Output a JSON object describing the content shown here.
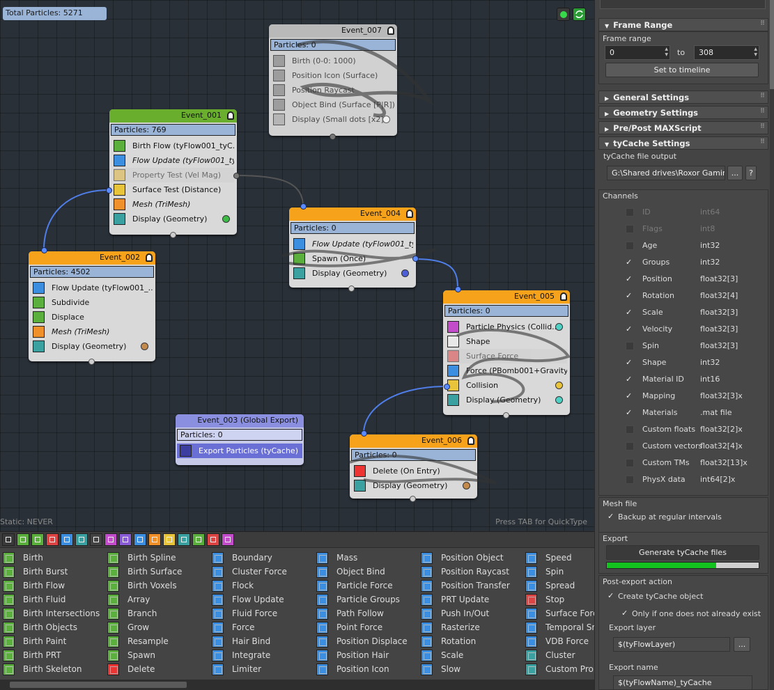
{
  "canvas": {
    "total_particles": "Total Particles: 5271",
    "static_label": "Static: NEVER",
    "tab_hint": "Press TAB for QuickType"
  },
  "colors": {
    "event_green": "#6aae2d",
    "event_orange": "#f7a21b",
    "event_purple": "#8a8fe0",
    "event_grey": "#b9b9b9",
    "particles_bar": "#9ab4d8",
    "wire_blue": "#4f7ee8",
    "wire_grey": "#555555",
    "progress_green": "#13c21f"
  },
  "events": {
    "e007": {
      "title": "Event_007",
      "count": "Particles: 0",
      "ops": [
        "Birth (0-0: 1000)",
        "Position Icon (Surface)",
        "Position Raycast",
        "Object Bind (Surface [P|R])",
        "Display (Small dots [x2])"
      ]
    },
    "e001": {
      "title": "Event_001",
      "count": "Particles: 769",
      "ops": [
        "Birth Flow (tyFlow001_tyC...",
        "Flow Update (tyFlow001_ty...",
        "Property Test (Vel Mag)",
        "Surface Test (Distance)",
        "Mesh (TriMesh)",
        "Display (Geometry)"
      ]
    },
    "e004": {
      "title": "Event_004",
      "count": "Particles: 0",
      "ops": [
        "Flow Update (tyFlow001_ty...",
        "Spawn (Once)",
        "Display (Geometry)"
      ]
    },
    "e002": {
      "title": "Event_002",
      "count": "Particles: 4502",
      "ops": [
        "Flow Update (tyFlow001_...",
        "Subdivide",
        "Displace",
        "Mesh (TriMesh)",
        "Display (Geometry)"
      ]
    },
    "e005": {
      "title": "Event_005",
      "count": "Particles: 0",
      "ops": [
        "Particle Physics (Collid...",
        "Shape",
        "Surface Force",
        "Force (PBomb001+Gravity)",
        "Collision",
        "Display (Geometry)"
      ]
    },
    "e003": {
      "title": "Event_003 (Global Export)",
      "count": "Particles: 0",
      "ops": [
        "Export Particles (tyCache)"
      ]
    },
    "e006": {
      "title": "Event_006",
      "count": "Particles: 0",
      "ops": [
        "Delete (On Entry)",
        "Display (Geometry)"
      ]
    }
  },
  "depot": {
    "columns": [
      [
        "Birth",
        "Birth Burst",
        "Birth Flow",
        "Birth Fluid",
        "Birth Intersections",
        "Birth Objects",
        "Birth Paint",
        "Birth PRT",
        "Birth Skeleton"
      ],
      [
        "Birth Spline",
        "Birth Surface",
        "Birth Voxels",
        "Array",
        "Branch",
        "Grow",
        "Resample",
        "Spawn",
        "Delete"
      ],
      [
        "Boundary",
        "Cluster Force",
        "Flock",
        "Flow Update",
        "Fluid Force",
        "Force",
        "Hair Bind",
        "Integrate",
        "Limiter"
      ],
      [
        "Mass",
        "Object Bind",
        "Particle Force",
        "Particle Groups",
        "Path Follow",
        "Point Force",
        "Position Displace",
        "Position Hair",
        "Position Icon"
      ],
      [
        "Position Object",
        "Position Raycast",
        "Position Transfer",
        "PRT Update",
        "Push In/Out",
        "Rasterize",
        "Rotation",
        "Scale",
        "Slow"
      ],
      [
        "Speed",
        "Spin",
        "Spread",
        "Stop",
        "Surface Force",
        "Temporal Sm",
        "VDB Force",
        "Cluster",
        "Custom Prop"
      ]
    ]
  },
  "panel": {
    "frame_range": {
      "header": "Frame Range",
      "label": "Frame range",
      "from": "0",
      "to_label": "to",
      "to": "308",
      "set_button": "Set to timeline"
    },
    "rollouts": {
      "general": "General Settings",
      "geometry": "Geometry Settings",
      "prepost": "Pre/Post MAXScript",
      "tycache": "tyCache Settings"
    },
    "output": {
      "label": "tyCache file output",
      "path": "G:\\Shared drives\\Roxor Gaming (",
      "browse": "...",
      "help": "?"
    },
    "channels_label": "Channels",
    "channels": [
      {
        "name": "ID",
        "type": "int64",
        "checked": false,
        "enabled": false
      },
      {
        "name": "Flags",
        "type": "int8",
        "checked": false,
        "enabled": false
      },
      {
        "name": "Age",
        "type": "int32",
        "checked": false,
        "enabled": true
      },
      {
        "name": "Groups",
        "type": "int32",
        "checked": true,
        "enabled": true
      },
      {
        "name": "Position",
        "type": "float32[3]",
        "checked": true,
        "enabled": true
      },
      {
        "name": "Rotation",
        "type": "float32[4]",
        "checked": true,
        "enabled": true
      },
      {
        "name": "Scale",
        "type": "float32[3]",
        "checked": true,
        "enabled": true
      },
      {
        "name": "Velocity",
        "type": "float32[3]",
        "checked": true,
        "enabled": true
      },
      {
        "name": "Spin",
        "type": "float32[3]",
        "checked": false,
        "enabled": true
      },
      {
        "name": "Shape",
        "type": "int32",
        "checked": true,
        "enabled": true
      },
      {
        "name": "Material ID",
        "type": "int16",
        "checked": true,
        "enabled": true
      },
      {
        "name": "Mapping",
        "type": "float32[3]x",
        "checked": true,
        "enabled": true
      },
      {
        "name": "Materials",
        "type": ".mat file",
        "checked": true,
        "enabled": true
      },
      {
        "name": "Custom floats",
        "type": "float32[2]x",
        "checked": false,
        "enabled": true
      },
      {
        "name": "Custom vectors",
        "type": "float32[4]x",
        "checked": false,
        "enabled": true
      },
      {
        "name": "Custom TMs",
        "type": "float32[13]x",
        "checked": false,
        "enabled": true
      },
      {
        "name": "PhysX data",
        "type": "int64[2]x",
        "checked": false,
        "enabled": true
      }
    ],
    "mesh_file": {
      "label": "Mesh file",
      "backup": "Backup at regular intervals",
      "checked": true
    },
    "export": {
      "label": "Export",
      "button": "Generate tyCache files",
      "progress": 0.72
    },
    "post_export": {
      "label": "Post-export action",
      "create": "Create tyCache object",
      "only_if": "Only if one does not already exist",
      "layer_label": "Export layer",
      "layer_value": "$(tyFlowLayer)",
      "layer_btn": "...",
      "name_label": "Export name",
      "name_value": "$(tyFlowName)_tyCache"
    }
  }
}
